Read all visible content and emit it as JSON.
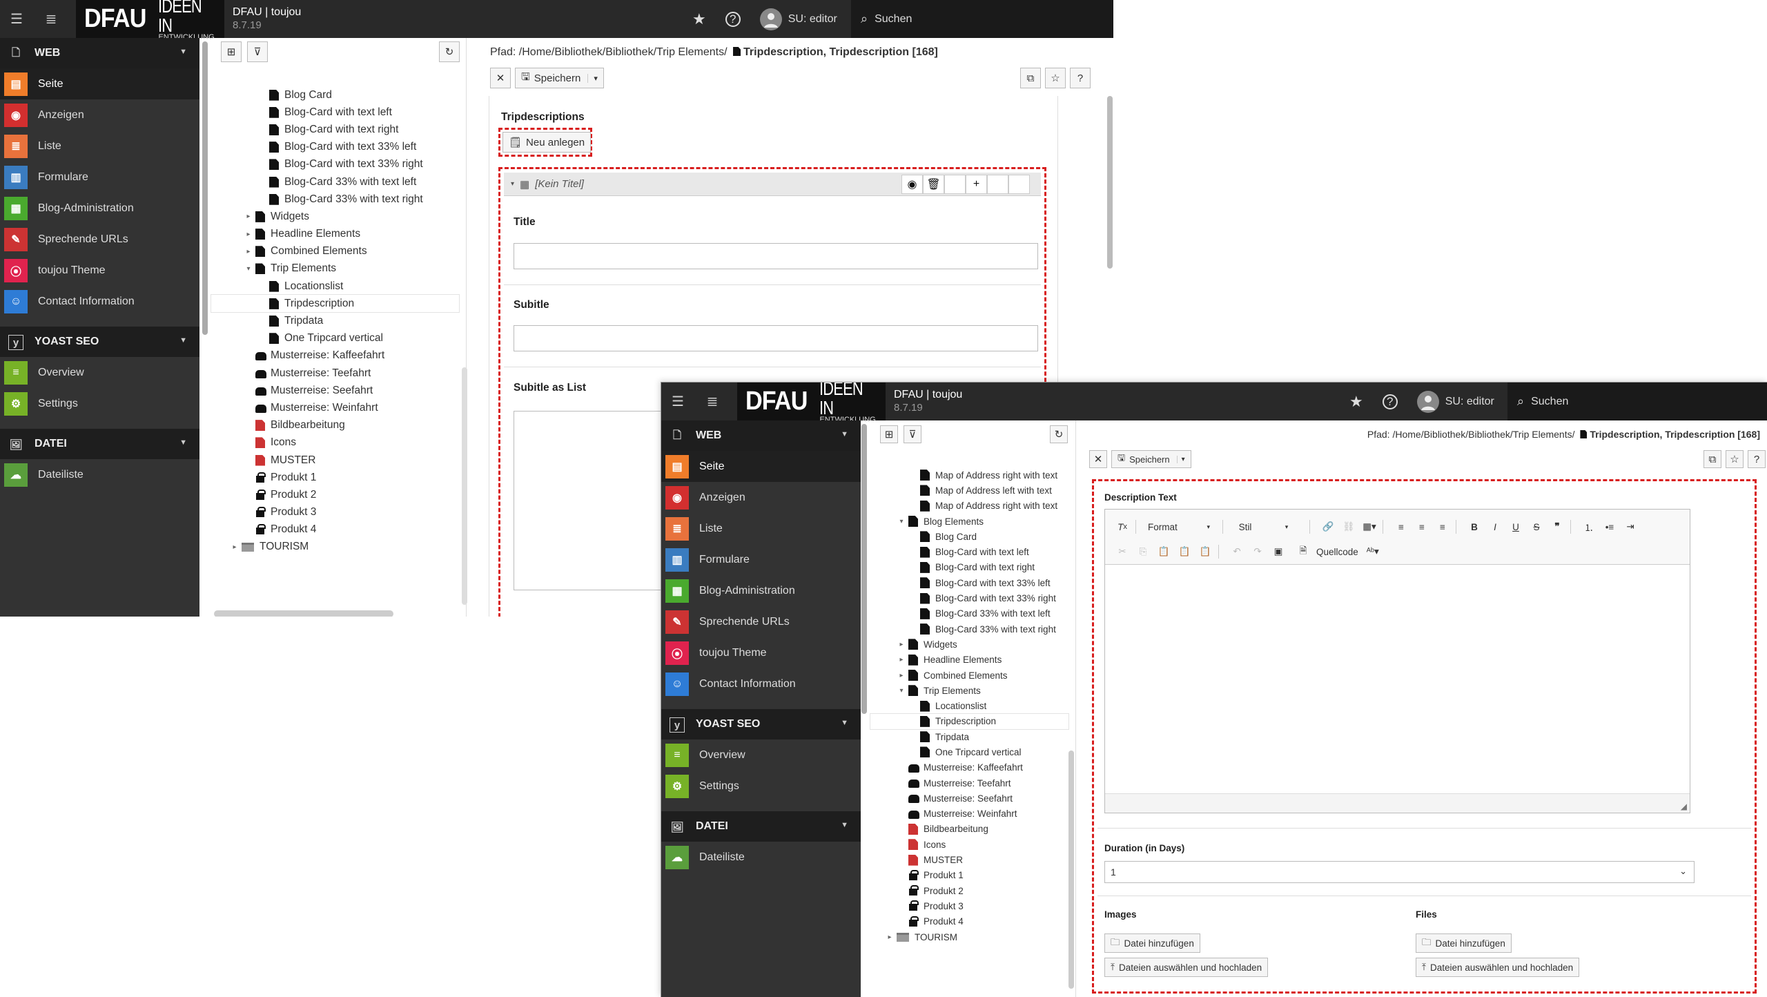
{
  "topbar": {
    "logo_main": "DFAU",
    "logo_sub1": "IDEEN IN",
    "logo_sub2": "ENTWICKLUNG",
    "site_name": "DFAU | toujou",
    "version": "8.7.19",
    "user": "SU: editor",
    "search": "Suchen"
  },
  "modules": {
    "web": "WEB",
    "web_items": [
      "Seite",
      "Anzeigen",
      "Liste",
      "Formulare",
      "Blog-Administration",
      "Sprechende URLs",
      "toujou Theme",
      "Contact Information"
    ],
    "yoast": "YOAST SEO",
    "yoast_items": [
      "Overview",
      "Settings"
    ],
    "datei": "DATEI",
    "datei_items": [
      "Dateiliste"
    ],
    "colors": {
      "seite": "#f07d2a",
      "anzeigen": "#d32f2f",
      "liste": "#e8723c",
      "formulare": "#3a7cc0",
      "blog": "#4aaa2e",
      "urls": "#c33",
      "theme": "#e0234e",
      "contact": "#2e7cd6",
      "yoast_green": "#77b227"
    }
  },
  "tree1": {
    "top_cut": "Blog Elements",
    "items": [
      {
        "indent": 2,
        "icon": "doc",
        "label": "Blog Card"
      },
      {
        "indent": 2,
        "icon": "doc",
        "label": "Blog-Card with text left"
      },
      {
        "indent": 2,
        "icon": "doc",
        "label": "Blog-Card with text right"
      },
      {
        "indent": 2,
        "icon": "doc",
        "label": "Blog-Card with text 33% left"
      },
      {
        "indent": 2,
        "icon": "doc",
        "label": "Blog-Card with text 33% right"
      },
      {
        "indent": 2,
        "icon": "doc",
        "label": "Blog-Card 33% with text left"
      },
      {
        "indent": 2,
        "icon": "doc",
        "label": "Blog-Card 33% with text right"
      },
      {
        "indent": 1,
        "icon": "doc",
        "toggle": "▸",
        "label": "Widgets"
      },
      {
        "indent": 1,
        "icon": "doc",
        "toggle": "▸",
        "label": "Headline Elements"
      },
      {
        "indent": 1,
        "icon": "doc",
        "toggle": "▸",
        "label": "Combined Elements"
      },
      {
        "indent": 1,
        "icon": "doc",
        "toggle": "▾",
        "label": "Trip Elements"
      },
      {
        "indent": 2,
        "icon": "doc",
        "label": "Locationslist"
      },
      {
        "indent": 2,
        "icon": "doc",
        "label": "Tripdescription",
        "selected": true
      },
      {
        "indent": 2,
        "icon": "doc",
        "label": "Tripdata"
      },
      {
        "indent": 2,
        "icon": "doc",
        "label": "One Tripcard vertical"
      },
      {
        "indent": 1,
        "icon": "grp",
        "label": "Musterreise: Kaffeefahrt"
      },
      {
        "indent": 1,
        "icon": "grp",
        "label": "Musterreise: Teefahrt"
      },
      {
        "indent": 1,
        "icon": "grp",
        "label": "Musterreise: Seefahrt"
      },
      {
        "indent": 1,
        "icon": "grp",
        "label": "Musterreise: Weinfahrt"
      },
      {
        "indent": 1,
        "icon": "red",
        "label": "Bildbearbeitung"
      },
      {
        "indent": 1,
        "icon": "red",
        "label": "Icons"
      },
      {
        "indent": 1,
        "icon": "red",
        "label": "MUSTER"
      },
      {
        "indent": 1,
        "icon": "gift",
        "label": "Produkt 1"
      },
      {
        "indent": 1,
        "icon": "gift",
        "label": "Produkt 2"
      },
      {
        "indent": 1,
        "icon": "gift",
        "label": "Produkt 3"
      },
      {
        "indent": 1,
        "icon": "gift",
        "label": "Produkt 4"
      },
      {
        "indent": 0,
        "icon": "fold",
        "toggle": "▸",
        "label": "TOURISM"
      }
    ]
  },
  "tree2": {
    "items": [
      {
        "indent": 2,
        "icon": "doc",
        "label": "Map of Address right with text"
      },
      {
        "indent": 2,
        "icon": "doc",
        "label": "Map of Address left with text"
      },
      {
        "indent": 2,
        "icon": "doc",
        "label": "Map of Address right with text"
      },
      {
        "indent": 1,
        "icon": "doc",
        "toggle": "▾",
        "label": "Blog Elements"
      },
      {
        "indent": 2,
        "icon": "doc",
        "label": "Blog Card"
      },
      {
        "indent": 2,
        "icon": "doc",
        "label": "Blog-Card with text left"
      },
      {
        "indent": 2,
        "icon": "doc",
        "label": "Blog-Card with text right"
      },
      {
        "indent": 2,
        "icon": "doc",
        "label": "Blog-Card with text 33% left"
      },
      {
        "indent": 2,
        "icon": "doc",
        "label": "Blog-Card with text 33% right"
      },
      {
        "indent": 2,
        "icon": "doc",
        "label": "Blog-Card 33% with text left"
      },
      {
        "indent": 2,
        "icon": "doc",
        "label": "Blog-Card 33% with text right"
      },
      {
        "indent": 1,
        "icon": "doc",
        "toggle": "▸",
        "label": "Widgets"
      },
      {
        "indent": 1,
        "icon": "doc",
        "toggle": "▸",
        "label": "Headline Elements"
      },
      {
        "indent": 1,
        "icon": "doc",
        "toggle": "▸",
        "label": "Combined Elements"
      },
      {
        "indent": 1,
        "icon": "doc",
        "toggle": "▾",
        "label": "Trip Elements"
      },
      {
        "indent": 2,
        "icon": "doc",
        "label": "Locationslist"
      },
      {
        "indent": 2,
        "icon": "doc",
        "label": "Tripdescription",
        "selected": true
      },
      {
        "indent": 2,
        "icon": "doc",
        "label": "Tripdata"
      },
      {
        "indent": 2,
        "icon": "doc",
        "label": "One Tripcard vertical"
      },
      {
        "indent": 1,
        "icon": "grp",
        "label": "Musterreise: Kaffeefahrt"
      },
      {
        "indent": 1,
        "icon": "grp",
        "label": "Musterreise: Teefahrt"
      },
      {
        "indent": 1,
        "icon": "grp",
        "label": "Musterreise: Seefahrt"
      },
      {
        "indent": 1,
        "icon": "grp",
        "label": "Musterreise: Weinfahrt"
      },
      {
        "indent": 1,
        "icon": "red",
        "label": "Bildbearbeitung"
      },
      {
        "indent": 1,
        "icon": "red",
        "label": "Icons"
      },
      {
        "indent": 1,
        "icon": "red",
        "label": "MUSTER"
      },
      {
        "indent": 1,
        "icon": "gift",
        "label": "Produkt 1"
      },
      {
        "indent": 1,
        "icon": "gift",
        "label": "Produkt 2"
      },
      {
        "indent": 1,
        "icon": "gift",
        "label": "Produkt 3"
      },
      {
        "indent": 1,
        "icon": "gift",
        "label": "Produkt 4"
      },
      {
        "indent": 0,
        "icon": "fold",
        "toggle": "▸",
        "label": "TOURISM"
      }
    ]
  },
  "doc": {
    "path_prefix": "Pfad: /Home/Bibliothek/Bibliothek/Trip Elements/",
    "path_prefix2": "Pfad: /Home/Bibliothek/Bibliothek/Trip Elements/",
    "record": "Tripdescription, Tripdescription [168]",
    "save": "Speichern",
    "section_title": "Tripdescriptions",
    "new_button": "Neu anlegen",
    "no_title": "[Kein Titel]",
    "title_label": "Title",
    "subtitle_label": "Subitle",
    "subtitle_list_label": "Subitle as List",
    "desc_label": "Description Text",
    "format": "Format",
    "style": "Stil",
    "source": "Quellcode",
    "duration_label": "Duration (in Days)",
    "duration_value": "1",
    "images_label": "Images",
    "files_label": "Files",
    "add_file": "Datei hinzufügen",
    "upload": "Dateien auswählen und hochladen"
  }
}
